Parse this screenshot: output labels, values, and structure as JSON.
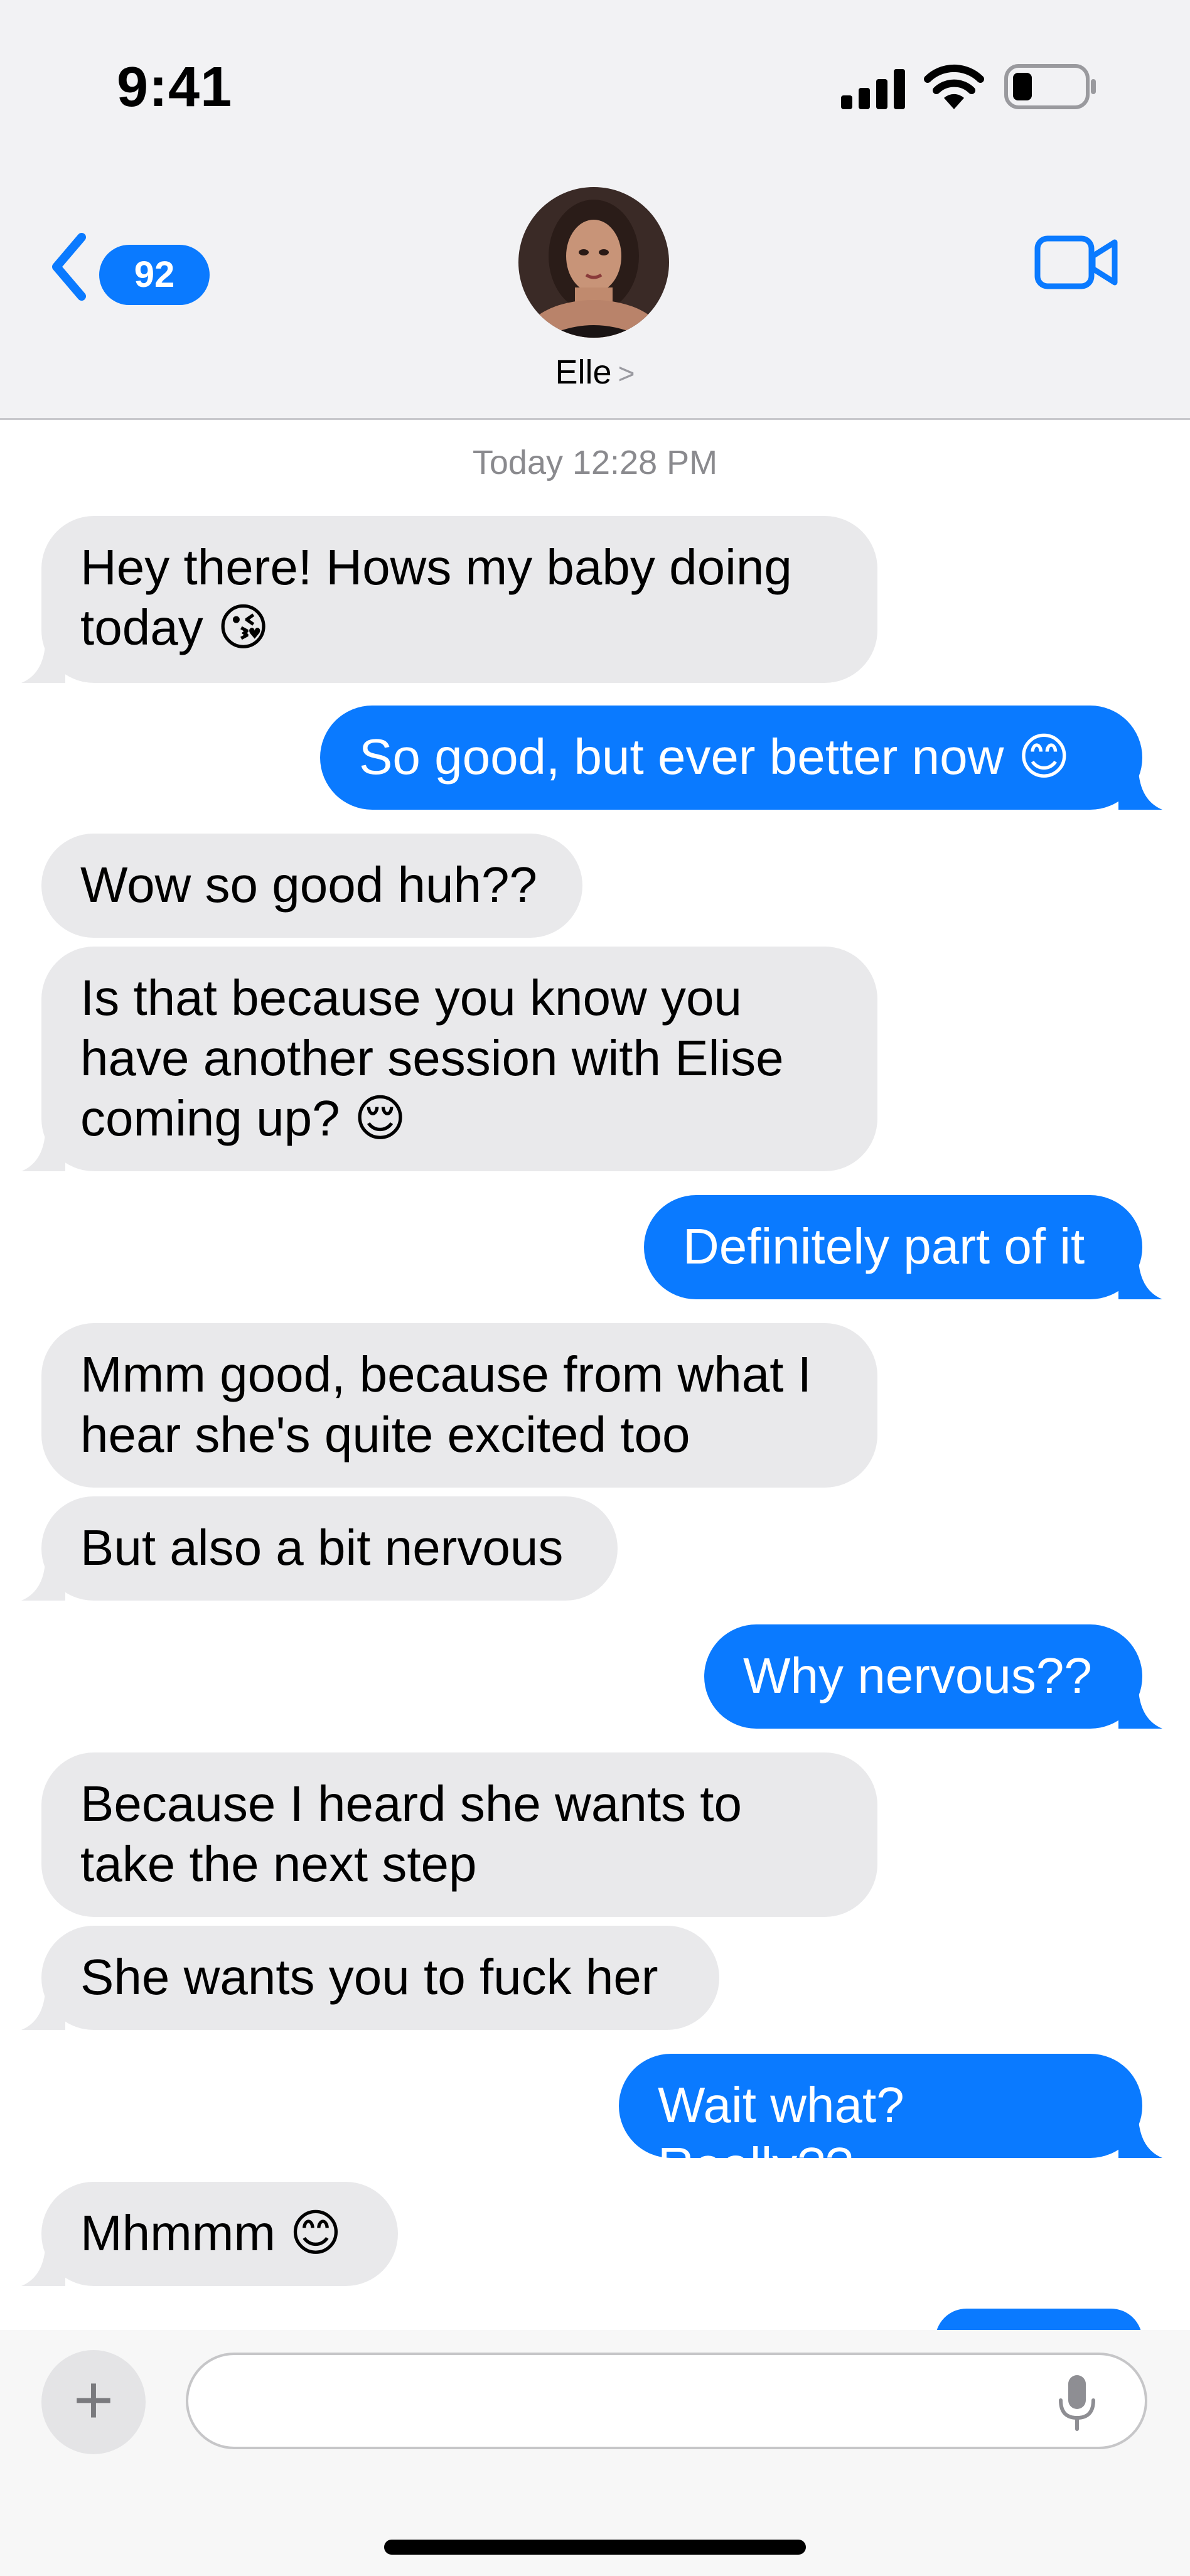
{
  "status_bar": {
    "time": "9:41"
  },
  "header": {
    "unread_count": "92",
    "contact_name": "Elle",
    "name_chevron": ">"
  },
  "thread": {
    "timestamp": "Today 12:28 PM",
    "messages": [
      {
        "from": "them",
        "text": "Hey there! Hows my baby doing today 😘"
      },
      {
        "from": "me",
        "text": "So good, but ever better now 😊"
      },
      {
        "from": "them",
        "text": "Wow so good huh??"
      },
      {
        "from": "them",
        "text": "Is that because you know you have another session with Elise coming up? 😌"
      },
      {
        "from": "me",
        "text": "Definitely part of it"
      },
      {
        "from": "them",
        "text": "Mmm good, because from what I hear she's quite excited too"
      },
      {
        "from": "them",
        "text": "But also a bit nervous"
      },
      {
        "from": "me",
        "text": "Why nervous??"
      },
      {
        "from": "them",
        "text": "Because I heard she wants to take the next step"
      },
      {
        "from": "them",
        "text": "She wants you to fuck her"
      },
      {
        "from": "me",
        "text": "Wait what? Really??"
      },
      {
        "from": "them",
        "text": "Mhmmm 😊"
      }
    ]
  },
  "composer": {
    "plus": "+",
    "placeholder": ""
  },
  "colors": {
    "outgoing": "#0a7aff",
    "incoming": "#e9e9eb",
    "header_bg": "#f2f2f4"
  }
}
